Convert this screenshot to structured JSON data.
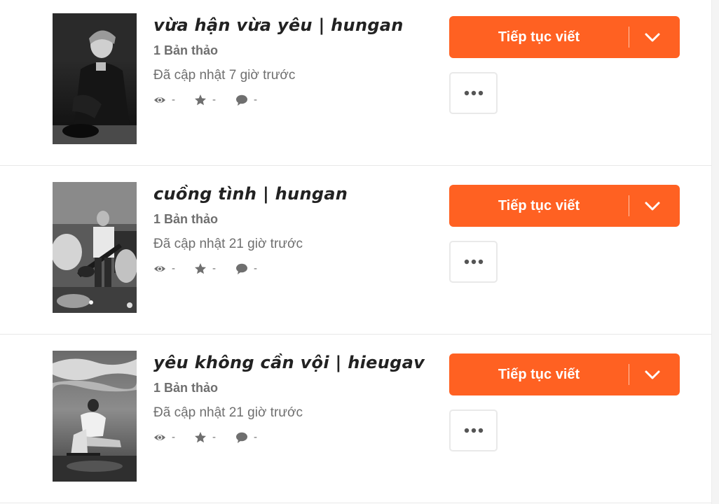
{
  "colors": {
    "accent": "#ff6122",
    "text_dark": "#222222",
    "text_muted": "#6f6f6f",
    "divider": "#e8e8e8"
  },
  "icons": {
    "views": "eye-icon",
    "votes": "star-icon",
    "comments": "comment-icon",
    "dropdown": "chevron-down-icon",
    "more": "more-options-icon"
  },
  "stories": [
    {
      "title": "vừa hận vừa yêu | hungan",
      "drafts": "1 Bản thảo",
      "updated": "Đã cập nhật 7 giờ trước",
      "views": "-",
      "votes": "-",
      "comments": "-",
      "continue_label": "Tiếp tục viết"
    },
    {
      "title": "cuồng tình | hungan",
      "drafts": "1 Bản thảo",
      "updated": "Đã cập nhật 21 giờ trước",
      "views": "-",
      "votes": "-",
      "comments": "-",
      "continue_label": "Tiếp tục viết"
    },
    {
      "title": "yêu không cần vội | hieugav",
      "drafts": "1 Bản thảo",
      "updated": "Đã cập nhật 21 giờ trước",
      "views": "-",
      "votes": "-",
      "comments": "-",
      "continue_label": "Tiếp tục viết"
    }
  ]
}
